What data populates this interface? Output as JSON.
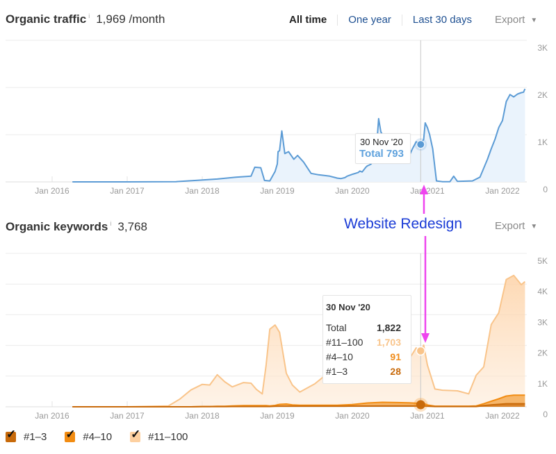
{
  "traffic": {
    "title": "Organic traffic",
    "info_icon": "i",
    "value": "1,969 /month",
    "range_options": [
      {
        "label": "All time",
        "active": true
      },
      {
        "label": "One year",
        "active": false
      },
      {
        "label": "Last 30 days",
        "active": false
      }
    ],
    "export_label": "Export",
    "tooltip": {
      "date": "30 Nov '20",
      "total_label": "Total 793"
    }
  },
  "keywords": {
    "title": "Organic keywords",
    "info_icon": "i",
    "value": "3,768",
    "export_label": "Export",
    "tooltip": {
      "date": "30 Nov '20",
      "rows": [
        {
          "label": "Total",
          "value": "1,822",
          "color": "#333333"
        },
        {
          "label": "#11–100",
          "value": "1,703",
          "color": "#f9c48a"
        },
        {
          "label": "#4–10",
          "value": "91",
          "color": "#f08c1a"
        },
        {
          "label": "#1–3",
          "value": "28",
          "color": "#c86a0a"
        }
      ]
    }
  },
  "annotation": {
    "label": "Website Redesign",
    "color": "#ee44ee"
  },
  "legend": [
    {
      "label": "#1–3",
      "color": "#c86a0a",
      "checked": true
    },
    {
      "label": "#4–10",
      "color": "#f28c12",
      "checked": true
    },
    {
      "label": "#11–100",
      "color": "#fdd0a0",
      "checked": true
    }
  ],
  "chart_data": [
    {
      "type": "area",
      "title": "Organic traffic",
      "xlabel": "",
      "ylabel": "",
      "x_ticks": [
        "Jan 2016",
        "Jan 2017",
        "Jan 2018",
        "Jan 2019",
        "Jan 2020",
        "Jan 2021",
        "Jan 2022"
      ],
      "y_ticks": [
        "0",
        "1K",
        "2K",
        "3K"
      ],
      "xlim": [
        2015.4,
        2022.35
      ],
      "ylim": [
        0,
        3000
      ],
      "grid": true,
      "color": "#5b9bd5",
      "highlight": {
        "x": 2020.91,
        "date": "30 Nov '20",
        "value": 793
      },
      "series": [
        {
          "name": "Total",
          "x": [
            2016.27,
            2017.0,
            2017.65,
            2017.9,
            2018.2,
            2018.45,
            2018.65,
            2018.7,
            2018.78,
            2018.83,
            2018.9,
            2018.97,
            2019.0,
            2019.01,
            2019.03,
            2019.06,
            2019.1,
            2019.15,
            2019.22,
            2019.27,
            2019.35,
            2019.45,
            2019.55,
            2019.7,
            2019.8,
            2019.85,
            2019.9,
            2019.93,
            2020.0,
            2020.08,
            2020.1,
            2020.13,
            2020.15,
            2020.18,
            2020.2,
            2020.23,
            2020.25,
            2020.28,
            2020.3,
            2020.33,
            2020.35,
            2020.38,
            2020.45,
            2020.55,
            2020.65,
            2020.72,
            2020.76,
            2020.8,
            2020.85,
            2020.91,
            2020.95,
            2020.97,
            2021.0,
            2021.03,
            2021.07,
            2021.12,
            2021.2,
            2021.3,
            2021.35,
            2021.4,
            2021.6,
            2021.7,
            2021.8,
            2021.85,
            2021.9,
            2021.95,
            2022.0,
            2022.05,
            2022.1,
            2022.15,
            2022.2,
            2022.25,
            2022.28,
            2022.3
          ],
          "y": [
            0,
            0,
            5,
            30,
            60,
            100,
            120,
            310,
            300,
            30,
            20,
            220,
            380,
            640,
            660,
            1080,
            600,
            640,
            480,
            560,
            420,
            180,
            150,
            120,
            80,
            70,
            90,
            120,
            160,
            200,
            230,
            210,
            250,
            310,
            340,
            360,
            380,
            460,
            530,
            900,
            1340,
            1060,
            850,
            690,
            660,
            780,
            560,
            700,
            850,
            793,
            900,
            1250,
            1150,
            1000,
            700,
            20,
            5,
            5,
            120,
            10,
            20,
            100,
            480,
            700,
            900,
            1150,
            1300,
            1700,
            1850,
            1800,
            1860,
            1890,
            1900,
            1970
          ]
        }
      ]
    },
    {
      "type": "area",
      "title": "Organic keywords",
      "xlabel": "",
      "ylabel": "",
      "x_ticks": [
        "Jan 2016",
        "Jan 2017",
        "Jan 2018",
        "Jan 2019",
        "Jan 2020",
        "Jan 2021",
        "Jan 2022"
      ],
      "y_ticks": [
        "0",
        "1K",
        "2K",
        "3K",
        "4K",
        "5K"
      ],
      "xlim": [
        2015.4,
        2022.35
      ],
      "ylim": [
        0,
        5000
      ],
      "grid": true,
      "stacked": true,
      "highlight": {
        "x": 2020.91,
        "date": "30 Nov '20",
        "total": 1822,
        "#11-100": 1703,
        "#4-10": 91,
        "#1-3": 28
      },
      "x": [
        2016.27,
        2017.0,
        2017.55,
        2017.7,
        2017.85,
        2018.0,
        2018.1,
        2018.2,
        2018.3,
        2018.4,
        2018.55,
        2018.65,
        2018.72,
        2018.8,
        2018.85,
        2018.9,
        2018.97,
        2019.03,
        2019.12,
        2019.2,
        2019.3,
        2019.5,
        2019.65,
        2019.8,
        2019.9,
        2020.0,
        2020.2,
        2020.4,
        2020.6,
        2020.75,
        2020.85,
        2020.91,
        2020.95,
        2021.0,
        2021.1,
        2021.2,
        2021.4,
        2021.55,
        2021.65,
        2021.75,
        2021.85,
        2021.95,
        2022.05,
        2022.15,
        2022.25,
        2022.3
      ],
      "series": [
        {
          "name": "#1-3",
          "color": "#c86a0a",
          "values": [
            0,
            0,
            0,
            0,
            0,
            5,
            5,
            5,
            5,
            10,
            10,
            10,
            10,
            10,
            10,
            10,
            15,
            20,
            20,
            20,
            20,
            20,
            20,
            20,
            20,
            25,
            25,
            28,
            28,
            28,
            28,
            28,
            28,
            20,
            10,
            10,
            10,
            10,
            10,
            40,
            60,
            80,
            100,
            100,
            100,
            100
          ]
        },
        {
          "name": "#4-10",
          "color": "#f28c12",
          "values": [
            0,
            0,
            0,
            0,
            0,
            5,
            5,
            10,
            10,
            20,
            30,
            30,
            30,
            30,
            30,
            20,
            30,
            60,
            70,
            40,
            30,
            30,
            30,
            30,
            40,
            50,
            100,
            120,
            110,
            100,
            91,
            91,
            80,
            40,
            10,
            10,
            10,
            10,
            20,
            60,
            120,
            180,
            250,
            280,
            280,
            280
          ]
        },
        {
          "name": "#11-100",
          "color": "#f9c48a",
          "values": [
            0,
            0,
            30,
            250,
            550,
            720,
            700,
            1030,
            800,
            620,
            750,
            730,
            530,
            380,
            1300,
            2500,
            2620,
            2350,
            1000,
            650,
            430,
            700,
            1000,
            1150,
            1350,
            1500,
            1200,
            1000,
            1250,
            1400,
            1800,
            1703,
            1900,
            1300,
            560,
            520,
            500,
            400,
            1000,
            1200,
            2500,
            2800,
            3800,
            3900,
            3600,
            3700
          ]
        }
      ]
    }
  ]
}
